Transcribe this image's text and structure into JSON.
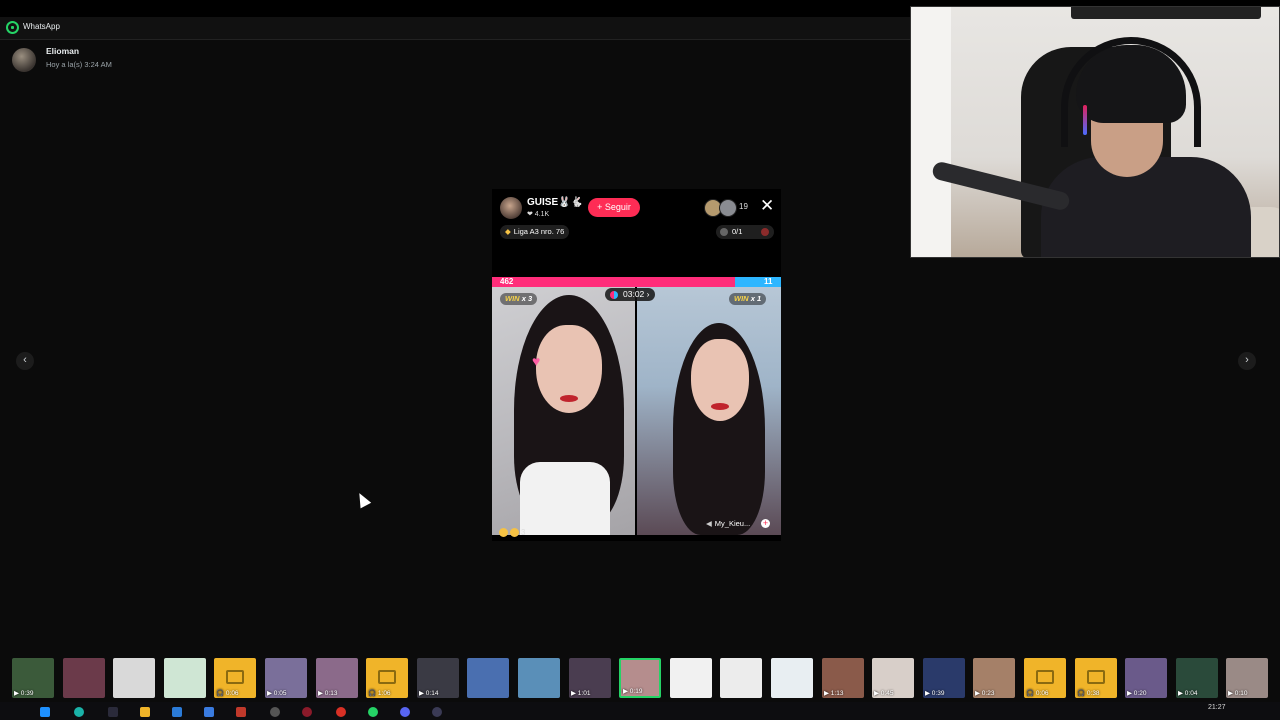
{
  "app": {
    "title": "WhatsApp"
  },
  "message": {
    "sender": "Elioman",
    "time": "Hoy a la(s) 3:24 AM"
  },
  "nav": {
    "prev": "‹",
    "next": "›"
  },
  "tiktok": {
    "host_name": "GUISE🐰🐇",
    "host_likes": "❤ 4.1K",
    "follow_label": "+ Seguir",
    "viewer_count": "19",
    "close": "✕",
    "league_label": "Liga A3 nro. 76",
    "counter": "0/1",
    "score_left": "462",
    "score_right": "11",
    "timer": "03:02 ›",
    "win_left": {
      "win": "WIN",
      "mult": "x 3"
    },
    "win_right": {
      "win": "WIN",
      "mult": "x 1"
    },
    "heart": "♥",
    "reactions_count": "3",
    "guest_name": "My_Kieu...",
    "guest_plus": "+",
    "speaker": "◀"
  },
  "thumbnails": [
    {
      "duration": "0:39",
      "color": "#3b5a3a",
      "type": "video"
    },
    {
      "duration": "",
      "color": "#6b3a4a",
      "type": "image"
    },
    {
      "duration": "",
      "color": "#d9d9d9",
      "type": "image"
    },
    {
      "duration": "",
      "color": "#cfe6d4",
      "type": "image"
    },
    {
      "duration": "0:06",
      "color": "#f0b429",
      "type": "audio"
    },
    {
      "duration": "0:05",
      "color": "#7a6f9a",
      "type": "video"
    },
    {
      "duration": "0:13",
      "color": "#8b6a8a",
      "type": "video"
    },
    {
      "duration": "1:06",
      "color": "#f0b429",
      "type": "audio"
    },
    {
      "duration": "0:14",
      "color": "#3a3a44",
      "type": "video"
    },
    {
      "duration": "",
      "color": "#4a6fb0",
      "type": "image"
    },
    {
      "duration": "",
      "color": "#5a8fb8",
      "type": "image"
    },
    {
      "duration": "1:01",
      "color": "#4a3d50",
      "type": "video"
    },
    {
      "duration": "0:19",
      "color": "#b58d8d",
      "type": "video"
    },
    {
      "duration": "",
      "color": "#f1f1f1",
      "type": "image"
    },
    {
      "duration": "",
      "color": "#ececec",
      "type": "image"
    },
    {
      "duration": "",
      "color": "#e8eef2",
      "type": "image"
    },
    {
      "duration": "1:13",
      "color": "#8a5a4a",
      "type": "video"
    },
    {
      "duration": "0:45",
      "color": "#d8cfc9",
      "type": "video"
    },
    {
      "duration": "0:39",
      "color": "#2a3a6a",
      "type": "video"
    },
    {
      "duration": "0:23",
      "color": "#a58068",
      "type": "video"
    },
    {
      "duration": "0:06",
      "color": "#f0b429",
      "type": "audio"
    },
    {
      "duration": "0:38",
      "color": "#f0b429",
      "type": "audio"
    },
    {
      "duration": "0:20",
      "color": "#6a5a8a",
      "type": "video"
    },
    {
      "duration": "0:04",
      "color": "#2a4a3a",
      "type": "video"
    },
    {
      "duration": "0:10",
      "color": "#9a8a86",
      "type": "video"
    }
  ],
  "taskbar": {
    "clock": "21:27"
  }
}
